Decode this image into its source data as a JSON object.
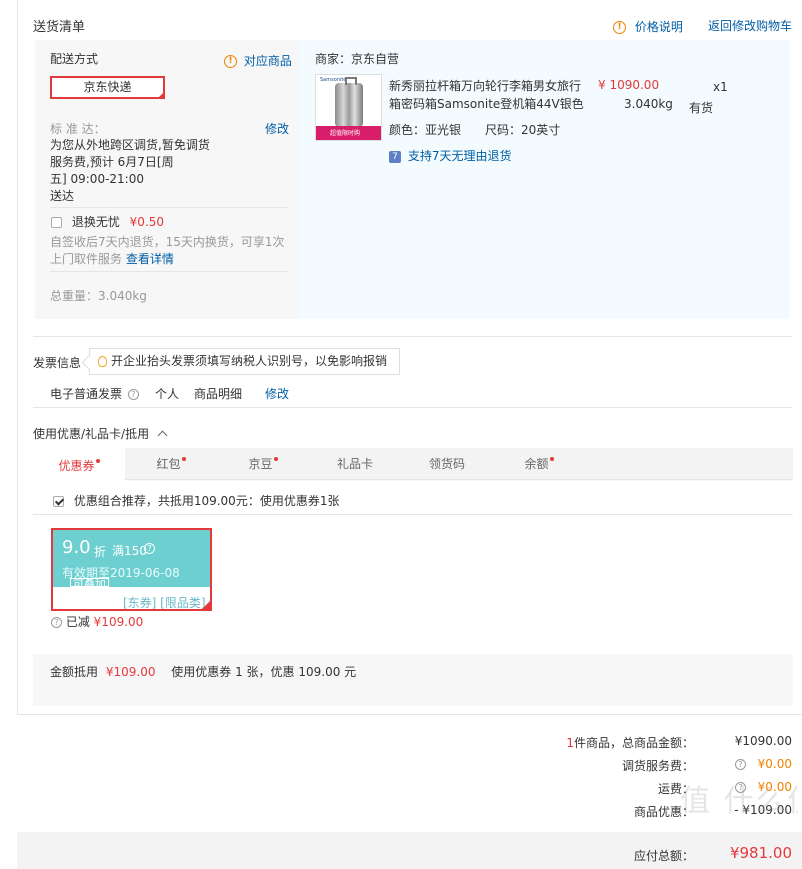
{
  "header": {
    "title": "送货清单",
    "price_explain": "价格说明",
    "back_to_cart": "返回修改购物车"
  },
  "shipping": {
    "method_label": "配送方式",
    "match_goods": "对应商品",
    "express": "京东快递",
    "standard_label": "标 准 达：",
    "modify": "修改",
    "delivery_text_1": "为您从外地跨区调货,暂免调货",
    "delivery_text_2": "服务费,预计 6月7日[周",
    "delivery_text_3": "五] 09:00-21:00",
    "delivery_text_4": "送达",
    "worry_free_label": "退换无忧",
    "worry_free_price": "¥0.50",
    "worry_free_desc_1": "自签收后7天内退货，15天内换货，可享1次",
    "worry_free_desc_2": "上门取件服务",
    "view_details": "查看详情",
    "total_weight": "总重量：3.040kg"
  },
  "product": {
    "seller": "商家：京东自营",
    "name_line1": "新秀丽拉杆箱万向轮行李箱男女旅行",
    "name_line2": "箱密码箱Samsonite登机箱44V银色",
    "price": "¥ 1090.00",
    "qty": "x1",
    "weight": "3.040kg",
    "stock": "有货",
    "color": "颜色：亚光银",
    "size": "尺码：20英寸",
    "return_badge": "7",
    "return_policy": "支持7天无理由退货",
    "img_brand": "Samsonite",
    "img_promo": "超值限时购"
  },
  "invoice": {
    "label": "发票信息",
    "tip": "开企业抬头发票须填写纳税人识别号，以免影响报销",
    "type": "电子普通发票",
    "title": "个人",
    "content": "商品明细",
    "modify": "修改"
  },
  "coupons": {
    "section_title": "使用优惠/礼品卡/抵用",
    "tabs": [
      {
        "label": "优惠券",
        "dot": true
      },
      {
        "label": "红包",
        "dot": true
      },
      {
        "label": "京豆",
        "dot": true
      },
      {
        "label": "礼品卡",
        "dot": false
      },
      {
        "label": "领货码",
        "dot": false
      },
      {
        "label": "余额",
        "dot": true
      }
    ],
    "recommend": "优惠组合推荐，共抵用109.00元：使用优惠券1张",
    "coupon": {
      "discount": "9.0",
      "unit": "折",
      "condition": "满150",
      "expiry": "有效期至2019-06-08",
      "stackable": "可叠加",
      "tags": "[东券] [限品类]"
    },
    "reduced_label": "已减",
    "reduced_amount": "¥109.00",
    "summary_label": "金额抵用",
    "summary_amount": "¥109.00",
    "summary_text": "使用优惠券 1 张，优惠 109.00 元"
  },
  "totals": {
    "item_count": "1",
    "items_label": "件商品，总商品金额：",
    "items_amount": "¥1090.00",
    "transfer_label": "调货服务费：",
    "transfer_amount": "¥0.00",
    "shipping_label": "运费：",
    "shipping_amount": "¥0.00",
    "discount_label": "商品优惠：",
    "discount_amount": "- ¥109.00",
    "payable_label": "应付总额：",
    "payable_amount": "¥981.00"
  },
  "watermark": "值 什么值得买 smzdm.com"
}
